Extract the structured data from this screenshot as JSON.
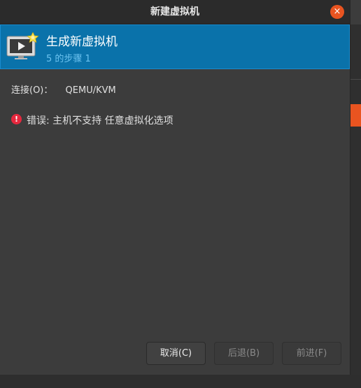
{
  "window": {
    "title": "新建虚拟机",
    "close_symbol": "×"
  },
  "header": {
    "title": "生成新虚拟机",
    "step": "5 的步骤 1",
    "icon": "monitor-with-star-icon"
  },
  "connection": {
    "label": "连接(O)：",
    "value": "QEMU/KVM"
  },
  "error": {
    "icon": "error-icon",
    "symbol": "!",
    "message": "错误: 主机不支持 任意虚拟化选项"
  },
  "buttons": {
    "cancel": "取消(C)",
    "back": "后退(B)",
    "forward": "前进(F)"
  },
  "colors": {
    "accent": "#e95420",
    "banner": "#0a72aa",
    "error": "#e6283e"
  }
}
